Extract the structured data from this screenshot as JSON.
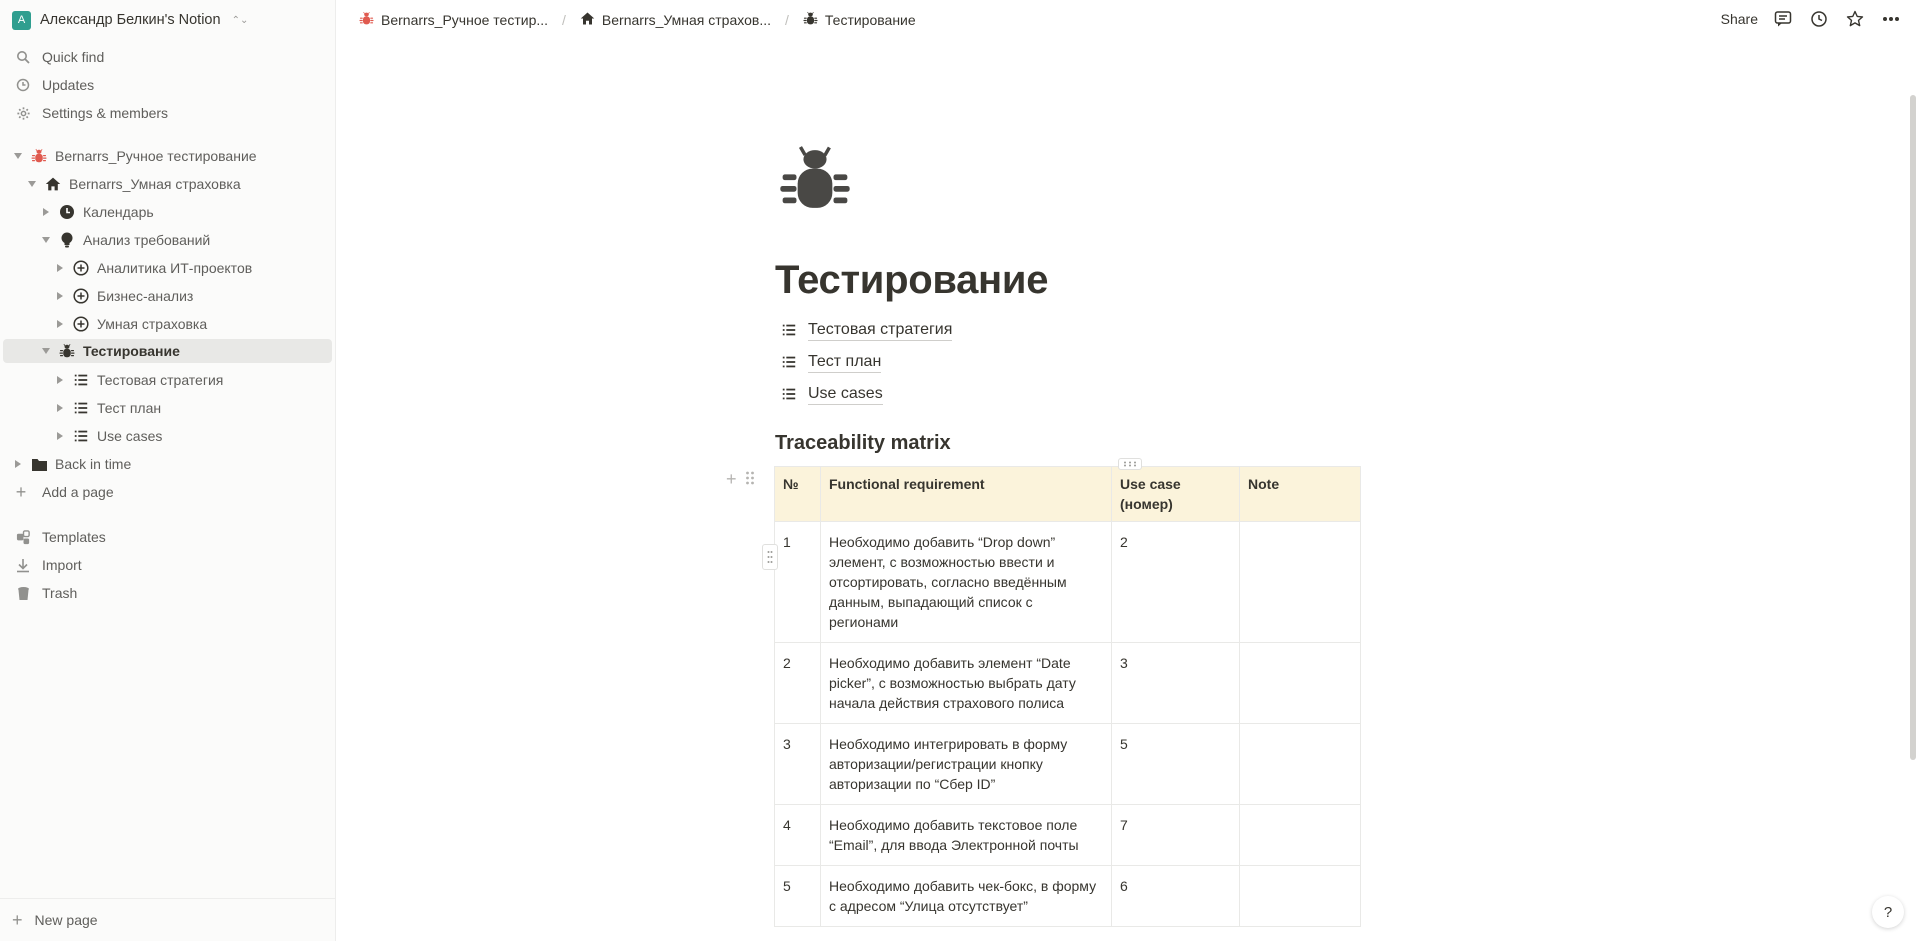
{
  "workspace": {
    "initial": "А",
    "name": "Александр Белкин's Notion"
  },
  "sidebar": {
    "utilities": [
      {
        "label": "Quick find",
        "icon": "search-icon"
      },
      {
        "label": "Updates",
        "icon": "clock-icon"
      },
      {
        "label": "Settings & members",
        "icon": "gear-icon"
      }
    ],
    "tree": [
      {
        "label": "Bernarrs_Ручное тестирование",
        "icon": "bug-icon"
      },
      {
        "label": "Bernarrs_Умная страховка",
        "icon": "home-icon"
      },
      {
        "label": "Календарь",
        "icon": "clock-icon"
      },
      {
        "label": "Анализ требований",
        "icon": "lightbulb-icon"
      },
      {
        "label": "Аналитика ИТ-проектов",
        "icon": "add-circle-icon"
      },
      {
        "label": "Бизнес-анализ",
        "icon": "add-circle-icon"
      },
      {
        "label": "Умная страховка",
        "icon": "add-circle-icon"
      },
      {
        "label": "Тестирование",
        "icon": "bug-icon"
      },
      {
        "label": "Тестовая стратегия",
        "icon": "list-icon"
      },
      {
        "label": "Тест план",
        "icon": "list-icon"
      },
      {
        "label": "Use cases",
        "icon": "list-icon"
      },
      {
        "label": "Back in time",
        "icon": "folder-icon"
      }
    ],
    "add_page": "Add a page",
    "bottom": [
      {
        "label": "Templates",
        "icon": "templates-icon"
      },
      {
        "label": "Import",
        "icon": "import-icon"
      },
      {
        "label": "Trash",
        "icon": "trash-icon"
      }
    ],
    "new_page": "New page"
  },
  "breadcrumbs": [
    {
      "label": "Bernarrs_Ручное тестир...",
      "icon": "bug-icon"
    },
    {
      "label": "Bernarrs_Умная страхов...",
      "icon": "home-icon"
    },
    {
      "label": "Тестирование",
      "icon": "bug-icon"
    }
  ],
  "topbar": {
    "share": "Share"
  },
  "page": {
    "title": "Тестирование",
    "icon": "bug-icon",
    "links": [
      "Тестовая стратегия",
      "Тест план",
      "Use cases"
    ],
    "heading": "Traceability matrix",
    "table": {
      "headers": [
        "№",
        "Functional requirement",
        "Use case (номер)",
        "Note"
      ],
      "rows": [
        [
          "1",
          "Необходимо добавить “Drop down” элемент, с возможностью ввести и отсортировать, согласно введённым данным, выпадающий список с регионами",
          "2",
          ""
        ],
        [
          "2",
          "Необходимо добавить элемент “Date picker”, с возможностью выбрать дату начала действия страхового полиса",
          "3",
          ""
        ],
        [
          "3",
          "Необходимо интегрировать в форму авторизации/регистрации кнопку авторизации по “Сбер ID”",
          "5",
          ""
        ],
        [
          "4",
          "Необходимо добавить текстовое поле “Email”, для ввода Электронной почты",
          "7",
          ""
        ],
        [
          "5",
          "Необходимо добавить чек-бокс, в форму с адресом “Улица отсутствует”",
          "6",
          ""
        ]
      ]
    }
  },
  "help": "?",
  "colors": {
    "accent_avatar": "#2f9e8f",
    "bug_red": "#e05a4f",
    "table_header": "#fbf3db",
    "sidebar_bg": "#fbfbfa"
  }
}
